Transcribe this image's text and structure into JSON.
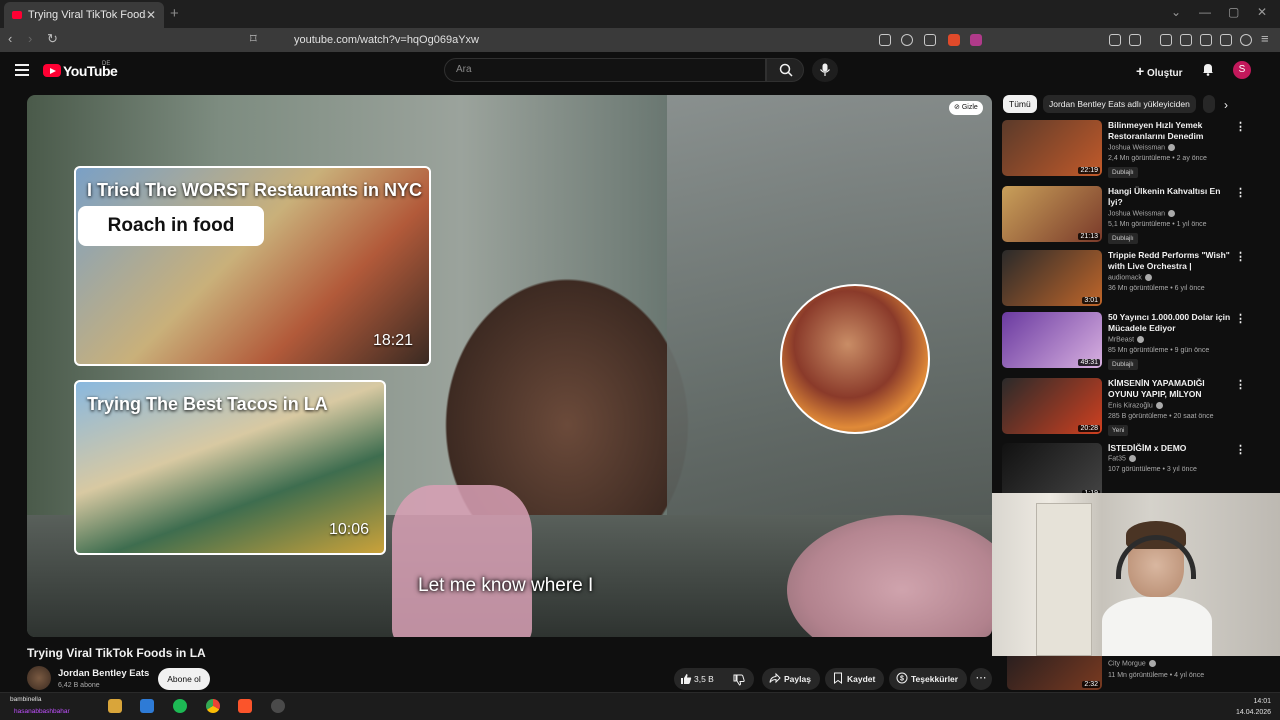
{
  "browser": {
    "tab_title": "Trying Viral TikTok Foods in LA -",
    "url": "youtube.com/watch?v=hqOg069aYxw"
  },
  "header": {
    "logo_text": "YouTube",
    "region": "DE",
    "search_placeholder": "Ara",
    "create_label": "Oluştur",
    "avatar_letter": "S"
  },
  "video": {
    "hide_label": "Gizle",
    "subtitle": "Let me know where I",
    "endscreen": [
      {
        "title": "I Tried The WORST Restaurants in NYC",
        "subtitle": "Roach in food",
        "duration": "18:21"
      },
      {
        "title": "Trying The Best Tacos in LA",
        "duration": "10:06"
      }
    ]
  },
  "below": {
    "title": "Trying Viral TikTok Foods in LA",
    "channel": "Jordan Bentley Eats",
    "subscribers": "6,42 B abone",
    "subscribe_label": "Abone ol",
    "likes": "3,5 B",
    "share_label": "Paylaş",
    "save_label": "Kaydet",
    "thanks_label": "Teşekkürler",
    "more_label": "⋯"
  },
  "sidebar": {
    "chips": [
      "Tümü",
      "Jordan Bentley Eats adlı yükleyiciden"
    ],
    "items": [
      {
        "title": "Bilinmeyen Hızlı Yemek Restoranlarını Denedim",
        "channel": "Joshua Weissman",
        "meta": "2,4 Mn görüntüleme • 2 ay önce",
        "badge": "Dublajlı",
        "duration": "22:19",
        "colors": [
          "#5a3a2a",
          "#c25a2a"
        ]
      },
      {
        "title": "Hangi Ülkenin Kahvaltısı En İyi?",
        "channel": "Joshua Weissman",
        "meta": "5,1 Mn görüntüleme • 1 yıl önce",
        "badge": "Dublajlı",
        "duration": "21:13",
        "colors": [
          "#c9a05a",
          "#7a3a2a"
        ]
      },
      {
        "title": "Trippie Redd Performs \"Wish\" with Live Orchestra | Audioma...",
        "channel": "audiomack",
        "meta": "36 Mn görüntüleme • 6 yıl önce",
        "badge": "",
        "duration": "3:01",
        "colors": [
          "#2a2a2a",
          "#c0662a"
        ]
      },
      {
        "title": "50 Yayıncı 1.000.000 Dolar için Mücadele Ediyor",
        "channel": "MrBeast",
        "meta": "85 Mn görüntüleme • 9 gün önce",
        "badge": "Dublajlı",
        "duration": "49:31",
        "colors": [
          "#6a3aa0",
          "#d8b0e0"
        ]
      },
      {
        "title": "KİMSENİN YAPAMADIĞI OYUNU YAPIP, MİLYON DOLARLAR ...",
        "channel": "Enis Kirazoğlu",
        "meta": "285 B görüntüleme • 20 saat önce",
        "badge": "Yeni",
        "duration": "20:28",
        "colors": [
          "#2a2a2a",
          "#d04020"
        ]
      },
      {
        "title": "İSTEDİĞİM x DEMO",
        "channel": "Fat35",
        "meta": "107 görüntüleme • 3 yıl önce",
        "badge": "",
        "duration": "1:19",
        "colors": [
          "#111111",
          "#444444"
        ]
      }
    ],
    "partial": {
      "channel": "City Morgue",
      "meta": "11 Mn görüntüleme • 4 yıl önce",
      "duration": "2:32"
    }
  },
  "taskbar": {
    "user": "bambinella",
    "user2": "hasanabbashbahar",
    "time": "14:01",
    "date": "14.04.2026"
  }
}
